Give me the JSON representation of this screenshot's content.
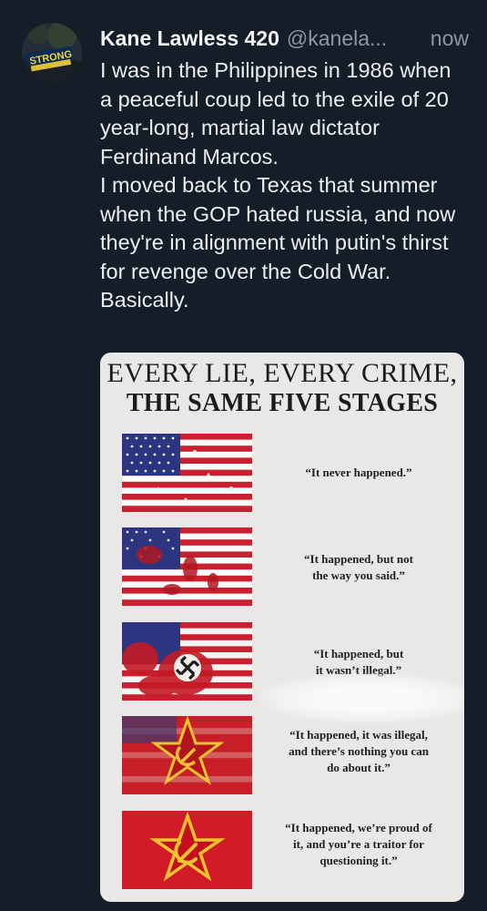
{
  "post": {
    "author": {
      "display_name": "Kane Lawless 420",
      "handle": "@kanela...",
      "avatar_icon": "avatar-strong-logo-icon"
    },
    "timestamp": "now",
    "text": "I was in the Philippines in 1986 when a peaceful coup led to the exile of 20 year-long, martial law dictator Ferdinand Marcos.\nI moved back to Texas that summer when the GOP hated russia, and now they're in alignment with putin's thirst for revenge over the Cold War. Basically."
  },
  "media": {
    "title_line1": "EVERY LIE, EVERY CRIME,",
    "title_line2": "THE SAME FIVE STAGES",
    "stages": [
      {
        "caption": "“It never happened.”",
        "flag_icon": "us-flag-icon"
      },
      {
        "caption": "“It happened, but not\nthe way you said.”",
        "flag_icon": "us-flag-bleeding-icon"
      },
      {
        "caption": "“It happened, but\nit wasn’t illegal.”",
        "flag_icon": "us-flag-swastika-icon"
      },
      {
        "caption": "“It happened, it was illegal,\nand there’s nothing you can\ndo about it.”",
        "flag_icon": "red-flag-star-hammer-sickle-icon"
      },
      {
        "caption": "“It happened, we’re proud of\nit, and you’re a traitor for\nquestioning it.”",
        "flag_icon": "soviet-flag-icon"
      }
    ]
  },
  "colors": {
    "background": "#151d28",
    "text_primary": "#e7e9ea",
    "text_secondary": "#8b98a5",
    "flag_red": "#b22234",
    "flag_blue": "#3c3b6e",
    "soviet_red": "#c8102e",
    "soviet_gold": "#f2c230"
  }
}
